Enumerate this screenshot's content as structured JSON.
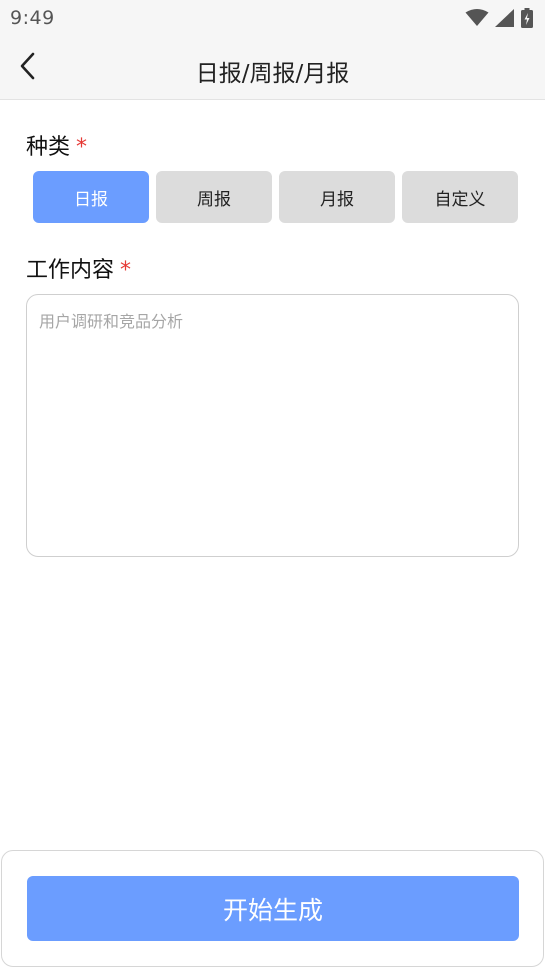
{
  "status_bar": {
    "time": "9:49",
    "icons": [
      "wifi-icon",
      "cellular-signal-icon",
      "battery-charging-icon"
    ]
  },
  "header": {
    "title": "日报/周报/月报",
    "back_icon": "chevron-left-icon"
  },
  "category": {
    "label": "种类",
    "required_mark": "*",
    "selected": "日报",
    "options": [
      {
        "label": "日报",
        "selected": true
      },
      {
        "label": "周报",
        "selected": false
      },
      {
        "label": "月报",
        "selected": false
      },
      {
        "label": "自定义",
        "selected": false
      }
    ]
  },
  "work_content": {
    "label": "工作内容",
    "required_mark": "*",
    "value": "",
    "placeholder": "用户调研和竞品分析"
  },
  "actions": {
    "generate_label": "开始生成"
  },
  "colors": {
    "accent": "#6b9dff",
    "required": "#e53935",
    "button_inactive": "#dcdcdc"
  }
}
